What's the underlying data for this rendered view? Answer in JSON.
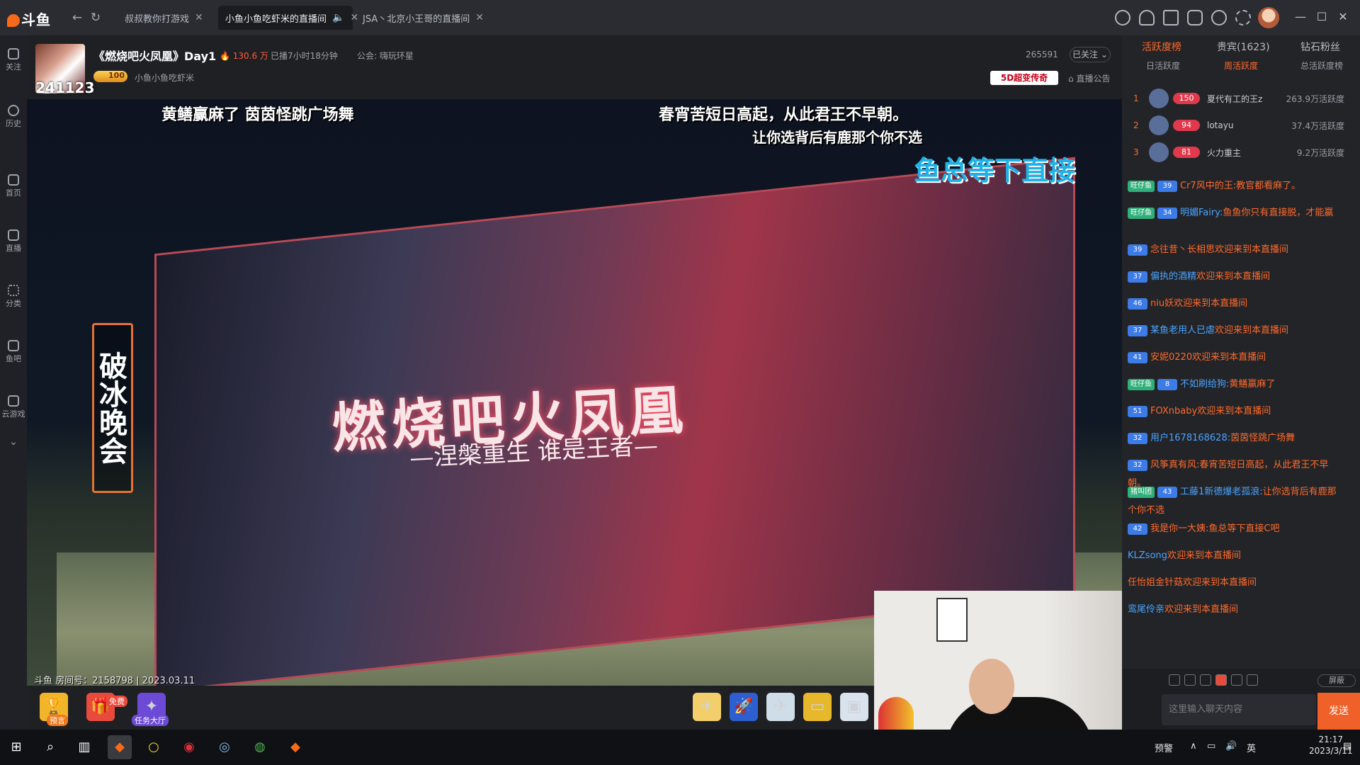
{
  "app": {
    "brand": "斗鱼"
  },
  "tabs": [
    {
      "label": "叔叔教你打游戏",
      "active": false
    },
    {
      "label": "小鱼小鱼吃虾米的直播间",
      "active": true
    },
    {
      "label": "JSA丶北京小王哥的直播间",
      "active": false
    }
  ],
  "stream": {
    "room_badge": "241123",
    "title": "《燃烧吧火凤凰》Day1",
    "heat": "130.6 万",
    "duration": "已播7小时18分钟",
    "guild": "公会: 嗨玩环星",
    "host_level": "100",
    "host": "小鱼小鱼吃虾米",
    "fans": "265591",
    "follow": "已关注",
    "badge": "5D超变传奇",
    "notice": "直播公告",
    "stamp": "斗鱼 房间号：2158798 | 2023.03.11"
  },
  "left_nav": [
    "关注",
    "历史",
    "首页",
    "直播",
    "分类",
    "鱼吧",
    "云游戏"
  ],
  "video": {
    "danmaku": [
      {
        "text": "黄鳝赢麻了  茵茵怪跳广场舞"
      },
      {
        "text": "春宵苦短日高起，从此君王不早朝。"
      },
      {
        "text": "让你选背后有鹿那个你不选"
      },
      {
        "text": "鱼总等下直接"
      }
    ],
    "banner_title": "燃烧吧火凤凰",
    "banner_sub": "—涅槃重生 谁是王者—",
    "side_plaque": "破冰晚会"
  },
  "gifts": [
    {
      "label": "预言",
      "icon": "trophy-icon"
    },
    {
      "label": "免费",
      "icon": "gift-box-icon"
    },
    {
      "label": "任务大厅",
      "icon": "task-icon"
    }
  ],
  "ranking": {
    "tabs": [
      "活跃度榜",
      "贵宾(1623)",
      "钻石粉丝"
    ],
    "subtabs": [
      "日活跃度",
      "周活跃度",
      "总活跃度榜"
    ],
    "rows": [
      {
        "n": "1",
        "level": "150",
        "name": "夏代有工的王z",
        "value": "263.9万活跃度"
      },
      {
        "n": "2",
        "level": "94",
        "name": "lotayu",
        "value": "37.4万活跃度"
      },
      {
        "n": "3",
        "level": "81",
        "name": "火力重主",
        "value": "9.2万活跃度"
      }
    ]
  },
  "chat": [
    {
      "fan": "旺仔鱼",
      "lv": "39",
      "nick": "Cr7风中的王:",
      "content": "教官都看麻了。"
    },
    {
      "fan": "旺仔鱼",
      "lv": "34",
      "nick": "明媚Fairy:",
      "content": "鱼鱼你只有直接脱，才能赢"
    },
    {
      "fan": "",
      "lv": "39",
      "nick": "念往昔丶长相思",
      "content": "欢迎来到本直播间"
    },
    {
      "fan": "",
      "lv": "37",
      "nick": "偏执的酒精",
      "content": "欢迎来到本直播间"
    },
    {
      "fan": "",
      "lv": "46",
      "nick": "niu妖",
      "content": "欢迎来到本直播间"
    },
    {
      "fan": "",
      "lv": "37",
      "nick": "某鱼老用人已虐",
      "content": "欢迎来到本直播间"
    },
    {
      "fan": "",
      "lv": "41",
      "nick": "安妮0220",
      "content": "欢迎来到本直播间"
    },
    {
      "fan": "旺仔鱼",
      "lv": "8",
      "nick": "不如刷给狗:",
      "content": "黄鳝赢麻了"
    },
    {
      "fan": "",
      "lv": "51",
      "nick": "FOXnbaby",
      "content": "欢迎来到本直播间"
    },
    {
      "fan": "",
      "lv": "32",
      "nick": "用户1678168628:",
      "content": "茵茵怪跳广场舞"
    },
    {
      "fan": "",
      "lv": "32",
      "nick": "风筝真有风:",
      "content": "春宵苦短日高起，从此君王不早朝。"
    },
    {
      "fan": "猪叫团",
      "lv": "43",
      "nick": "工藤1新德爆老孤浪:",
      "content": "让你选背后有鹿那个你不选"
    },
    {
      "fan": "",
      "lv": "42",
      "nick": "我是你一大姨:",
      "content": "鱼总等下直接C吧"
    },
    {
      "fan": "",
      "lv": "",
      "nick": "KLZsong",
      "content": "欢迎来到本直播间"
    },
    {
      "fan": "",
      "lv": "",
      "nick": "任怡姐金针菇",
      "content": "欢迎来到本直播间"
    },
    {
      "fan": "",
      "lv": "",
      "nick": "鸾尾伶亲",
      "content": "欢迎来到本直播间"
    }
  ],
  "chat_input": {
    "placeholder": "这里输入聊天内容",
    "send": "发送",
    "block": "屏蔽"
  },
  "taskbar": {
    "ime": "英",
    "time": "21:17",
    "date": "2023/3/11",
    "alert": "预警"
  }
}
